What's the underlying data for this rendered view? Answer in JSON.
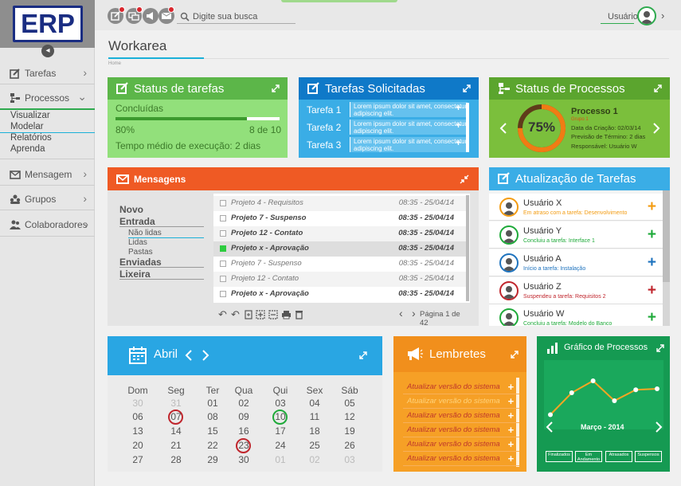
{
  "app": {
    "logo": "ERP"
  },
  "sidebar": {
    "items": [
      {
        "label": "Tarefas",
        "icon": "edit-icon"
      },
      {
        "label": "Processos",
        "icon": "process-icon"
      },
      {
        "label": "Mensagem",
        "icon": "mail-icon"
      },
      {
        "label": "Grupos",
        "icon": "groups-icon"
      },
      {
        "label": "Colaboradores",
        "icon": "collaborators-icon"
      }
    ],
    "subitems": [
      "Visualizar",
      "Modelar",
      "Relatórios",
      "Aprenda"
    ]
  },
  "topbar": {
    "search_placeholder": "Digite sua busca",
    "user_label": "Usuário"
  },
  "page": {
    "title": "Workarea",
    "breadcrumb": "Home"
  },
  "status_tarefas": {
    "title": "Status de tarefas",
    "label": "Concluídas",
    "percent": "80%",
    "progress": 0.8,
    "count": "8 de 10",
    "avg_time": "Tempo médio de execução: 2 dias"
  },
  "tarefas_solicitadas": {
    "title": "Tarefas Solicitadas",
    "items": [
      {
        "label": "Tarefa 1",
        "text": "Lorem ipsum dolor sit amet, consectetur adipiscing elit."
      },
      {
        "label": "Tarefa 2",
        "text": "Lorem ipsum dolor sit amet, consectetur adipiscing elit."
      },
      {
        "label": "Tarefa 3",
        "text": "Lorem ipsum dolor sit amet, consectetur adipiscing elit."
      }
    ]
  },
  "status_processos": {
    "title": "Status de Processos",
    "percent": "75%",
    "progress": 0.75,
    "process_name": "Processo 1",
    "group": "Grupo 1",
    "created": "Data da Criação: 02/03/14",
    "deadline": "Previsão de Término: 2 dias",
    "responsible": "Responsável: Usuário W"
  },
  "mensagens": {
    "title": "Mensagens",
    "folders": [
      "Novo",
      "Entrada",
      "Enviadas",
      "Lixeira"
    ],
    "subfolders": [
      "Não lidas",
      "Lidas",
      "Pastas"
    ],
    "rows": [
      {
        "subject": "Projeto 4 - Requisitos",
        "time": "08:35 - 25/04/14",
        "style": "ital"
      },
      {
        "subject": "Projeto 7 - Suspenso",
        "time": "08:35 - 25/04/14",
        "style": "bold"
      },
      {
        "subject": "Projeto 12 - Contato",
        "time": "08:35 - 25/04/14",
        "style": "bold"
      },
      {
        "subject": "Projeto x - Aprovação",
        "time": "08:35 - 25/04/14",
        "style": "bold"
      },
      {
        "subject": "Projeto 7 - Suspenso",
        "time": "08:35 - 25/04/14",
        "style": "ital"
      },
      {
        "subject": "Projeto 12 - Contato",
        "time": "08:35 - 25/04/14",
        "style": "ital"
      },
      {
        "subject": "Projeto x - Aprovação",
        "time": "08:35 - 25/04/14",
        "style": "bold"
      }
    ],
    "pagination": "Página 1 de 42"
  },
  "atualizacao": {
    "title": "Atualização de Tarefas",
    "rows": [
      {
        "user": "Usuário X",
        "action": "Em atraso com a tarefa:",
        "task": "Desenvolvimento",
        "color": "#f39c12"
      },
      {
        "user": "Usuário Y",
        "action": "Concluiu a tarefa:",
        "task": "Interface 1",
        "color": "#1faa3a"
      },
      {
        "user": "Usuário A",
        "action": "Início a tarefa:",
        "task": "Instalação",
        "color": "#1e73be"
      },
      {
        "user": "Usuário Z",
        "action": "Suspendeu a tarefa:",
        "task": "Requisitos 2",
        "color": "#c0262d"
      },
      {
        "user": "Usuário W",
        "action": "Concluiu a tarefa:",
        "task": "Modelo do Banco",
        "color": "#1faa3a"
      }
    ]
  },
  "calendar": {
    "month": "Abril",
    "weekdays": [
      "Dom",
      "Seg",
      "Ter",
      "Qua",
      "Qui",
      "Sex",
      "Sáb"
    ],
    "weeks": [
      [
        "30",
        "31",
        "01",
        "02",
        "03",
        "04",
        "05"
      ],
      [
        "06",
        "07",
        "08",
        "09",
        "10",
        "11",
        "12"
      ],
      [
        "13",
        "14",
        "15",
        "16",
        "17",
        "18",
        "19"
      ],
      [
        "20",
        "21",
        "22",
        "23",
        "24",
        "25",
        "26"
      ],
      [
        "27",
        "28",
        "29",
        "30",
        "01",
        "02",
        "03"
      ]
    ]
  },
  "lembretes": {
    "title": "Lembretes",
    "items": [
      "Atualizar versão do sistema",
      "Atualizar versão do sistema",
      "Atualizar versão do sistema",
      "Atualizar versão do sistema",
      "Atualizar versão do sistema",
      "Atualizar versão do sistema"
    ]
  },
  "grafico": {
    "title": "Gráfico de Processos",
    "period": "Março - 2014",
    "buttons": [
      "Finalizados",
      "Em Andamento",
      "Atrasados",
      "Suspensos"
    ]
  },
  "chart_data": {
    "type": "line",
    "x": [
      1,
      2,
      3,
      4,
      5,
      6
    ],
    "values": [
      1,
      3.2,
      4.4,
      2.4,
      3.5,
      3.6
    ],
    "ylim": [
      0,
      6
    ]
  }
}
